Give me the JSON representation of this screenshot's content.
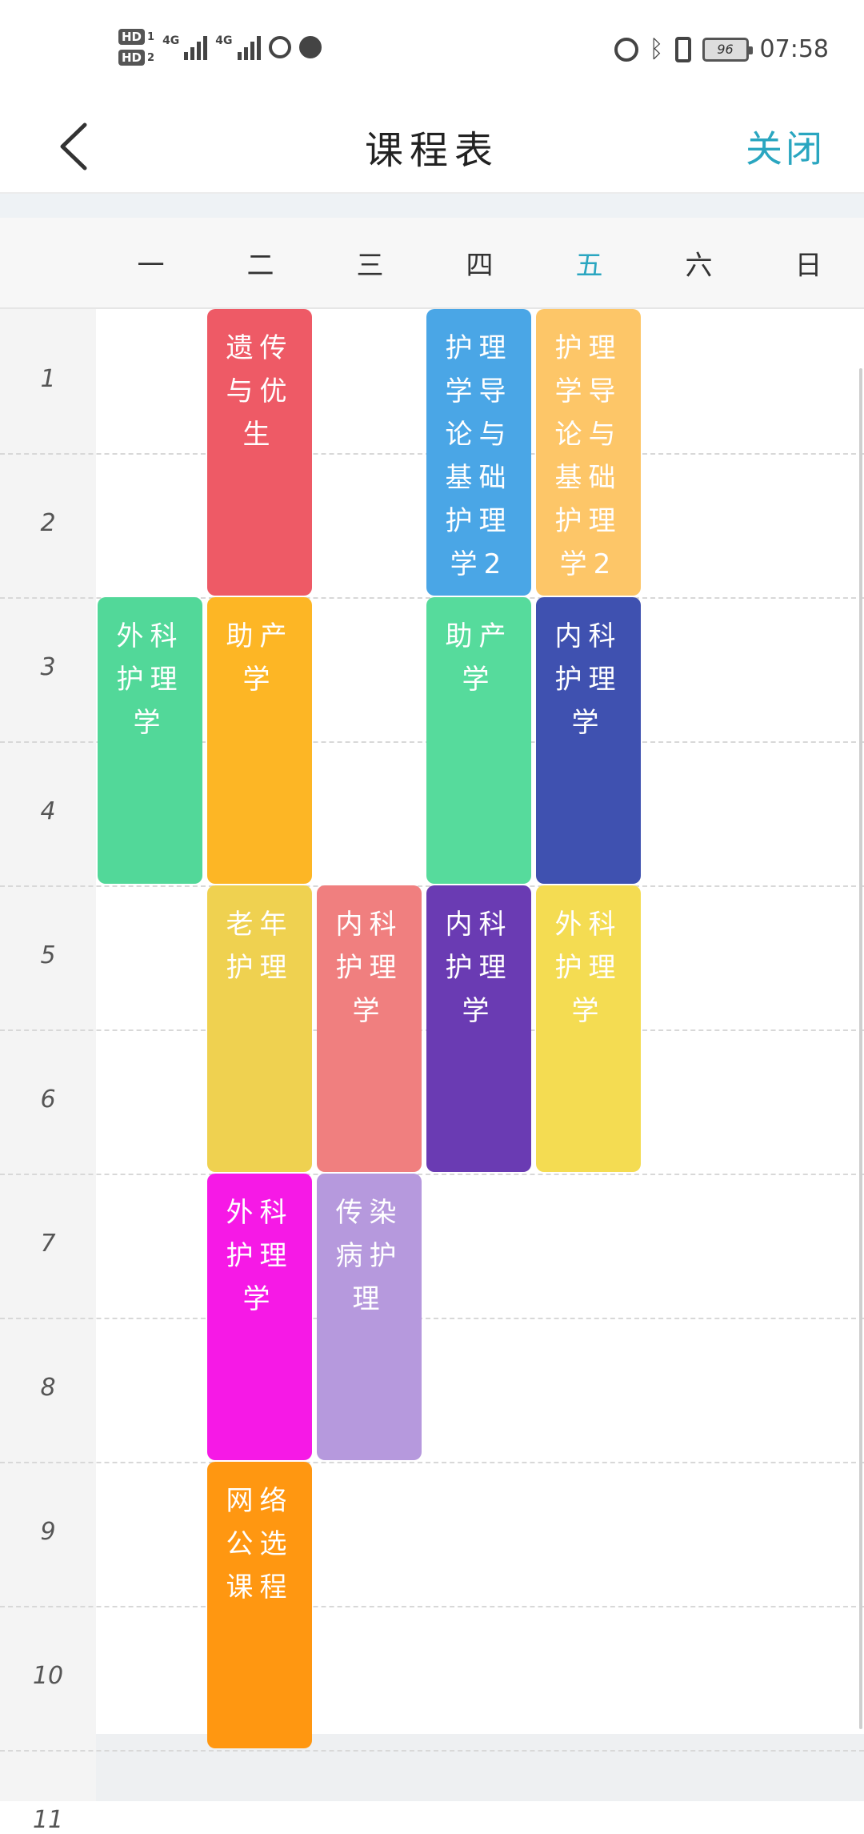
{
  "status_bar": {
    "hd1": "HD",
    "hd1_num": "1",
    "hd2": "HD",
    "hd2_num": "2",
    "sig1": "4G",
    "sig2": "4G",
    "battery": "96",
    "time": "07:58",
    "icons": [
      "alarm-icon",
      "bluetooth-icon",
      "vibrate-icon",
      "battery-icon"
    ]
  },
  "header": {
    "title": "课程表",
    "close_label": "关闭"
  },
  "weekdays": [
    {
      "label": "一"
    },
    {
      "label": "二"
    },
    {
      "label": "三"
    },
    {
      "label": "四"
    },
    {
      "label": "五"
    },
    {
      "label": "六"
    },
    {
      "label": "日"
    }
  ],
  "today_index": 4,
  "periods": [
    "1",
    "2",
    "3",
    "4",
    "5",
    "6",
    "7",
    "8",
    "9",
    "10",
    "11"
  ],
  "courses": [
    {
      "name": "遗传与优生",
      "day": 2,
      "start": 1,
      "end": 2,
      "color": "#ee5a66"
    },
    {
      "name": "护理学导论与基础护理学2",
      "day": 4,
      "start": 1,
      "end": 2,
      "color": "#4aa6e6"
    },
    {
      "name": "护理学导论与基础护理学2",
      "day": 5,
      "start": 1,
      "end": 2,
      "color": "#fdc668"
    },
    {
      "name": "外科护理学",
      "day": 1,
      "start": 3,
      "end": 4,
      "color": "#52d899"
    },
    {
      "name": "助产学",
      "day": 2,
      "start": 3,
      "end": 4,
      "color": "#fdb625"
    },
    {
      "name": "助产学",
      "day": 4,
      "start": 3,
      "end": 4,
      "color": "#56db9c"
    },
    {
      "name": "内科护理学",
      "day": 5,
      "start": 3,
      "end": 4,
      "color": "#3f51b0"
    },
    {
      "name": "老年护理",
      "day": 2,
      "start": 5,
      "end": 6,
      "color": "#efd150"
    },
    {
      "name": "内科护理学",
      "day": 3,
      "start": 5,
      "end": 6,
      "color": "#f07f7f"
    },
    {
      "name": "内科护理学",
      "day": 4,
      "start": 5,
      "end": 6,
      "color": "#6a3bb3"
    },
    {
      "name": "外科护理学",
      "day": 5,
      "start": 5,
      "end": 6,
      "color": "#f4dc52"
    },
    {
      "name": "外科护理学",
      "day": 2,
      "start": 7,
      "end": 8,
      "color": "#f619e6"
    },
    {
      "name": "传染病护理",
      "day": 3,
      "start": 7,
      "end": 8,
      "color": "#b699dd"
    },
    {
      "name": "网络公选课程",
      "day": 2,
      "start": 9,
      "end": 10,
      "color": "#ff9711"
    }
  ]
}
